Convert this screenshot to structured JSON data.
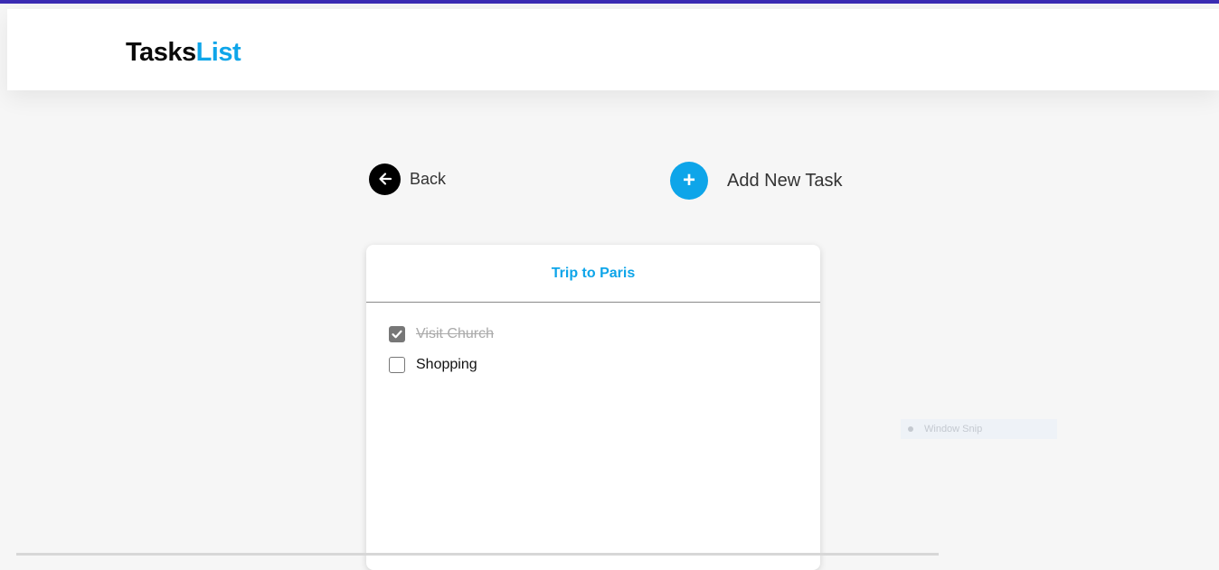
{
  "header": {
    "logo_part1": "Tasks",
    "logo_part2": "List"
  },
  "actions": {
    "back_label": "Back",
    "add_task_label": "Add New Task",
    "add_icon_glyph": "+"
  },
  "card": {
    "title": "Trip to Paris",
    "tasks": [
      {
        "label": "Visit Church",
        "checked": true
      },
      {
        "label": "Shopping",
        "checked": false
      }
    ]
  },
  "overlay": {
    "window_snip_label": "Window Snip"
  },
  "colors": {
    "accent": "#0ea5e9",
    "top_bar": "#3b2cb3",
    "background": "#f6f6f6"
  },
  "icons": {
    "back": "arrow-left-icon",
    "add": "plus-icon",
    "checked": "checkbox-checked-icon",
    "unchecked": "checkbox-unchecked-icon"
  }
}
